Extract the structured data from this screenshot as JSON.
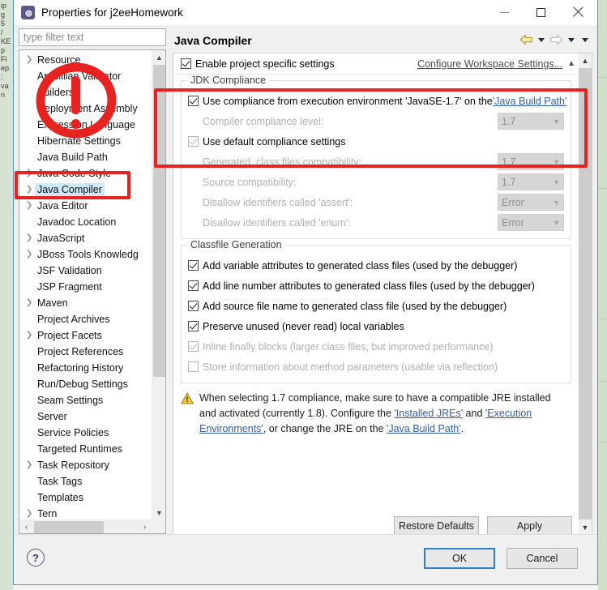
{
  "window": {
    "title": "Properties for j2eeHomework",
    "icon": "eclipse-properties-icon",
    "minimize_label": "Minimize",
    "maximize_label": "Maximize",
    "close_label": "Close"
  },
  "sidebar": {
    "filter_placeholder": "type filter text",
    "items": [
      {
        "label": "Resource",
        "expandable": true,
        "selected": false
      },
      {
        "label": "Arquillian Validator",
        "expandable": false,
        "selected": false
      },
      {
        "label": "Builders",
        "expandable": false,
        "selected": false
      },
      {
        "label": "Deployment Assembly",
        "expandable": false,
        "selected": false
      },
      {
        "label": "Expression Language",
        "expandable": false,
        "selected": false
      },
      {
        "label": "Hibernate Settings",
        "expandable": false,
        "selected": false
      },
      {
        "label": "Java Build Path",
        "expandable": false,
        "selected": false
      },
      {
        "label": "Java Code Style",
        "expandable": true,
        "selected": false
      },
      {
        "label": "Java Compiler",
        "expandable": true,
        "selected": true
      },
      {
        "label": "Java Editor",
        "expandable": true,
        "selected": false
      },
      {
        "label": "Javadoc Location",
        "expandable": false,
        "selected": false
      },
      {
        "label": "JavaScript",
        "expandable": true,
        "selected": false
      },
      {
        "label": "JBoss Tools Knowledg",
        "expandable": true,
        "selected": false
      },
      {
        "label": "JSF Validation",
        "expandable": false,
        "selected": false
      },
      {
        "label": "JSP Fragment",
        "expandable": false,
        "selected": false
      },
      {
        "label": "Maven",
        "expandable": true,
        "selected": false
      },
      {
        "label": "Project Archives",
        "expandable": false,
        "selected": false
      },
      {
        "label": "Project Facets",
        "expandable": true,
        "selected": false
      },
      {
        "label": "Project References",
        "expandable": false,
        "selected": false
      },
      {
        "label": "Refactoring History",
        "expandable": false,
        "selected": false
      },
      {
        "label": "Run/Debug Settings",
        "expandable": false,
        "selected": false
      },
      {
        "label": "Seam Settings",
        "expandable": false,
        "selected": false
      },
      {
        "label": "Server",
        "expandable": false,
        "selected": false
      },
      {
        "label": "Service Policies",
        "expandable": false,
        "selected": false
      },
      {
        "label": "Targeted Runtimes",
        "expandable": false,
        "selected": false
      },
      {
        "label": "Task Repository",
        "expandable": true,
        "selected": false
      },
      {
        "label": "Task Tags",
        "expandable": false,
        "selected": false
      },
      {
        "label": "Templates",
        "expandable": false,
        "selected": false
      },
      {
        "label": "Tern",
        "expandable": true,
        "selected": false
      }
    ]
  },
  "page": {
    "title": "Java Compiler",
    "nav": {
      "back_icon": "back-arrow-icon",
      "back_menu_icon": "chevron-down-icon",
      "forward_icon": "forward-arrow-icon",
      "forward_menu_icon": "chevron-down-icon",
      "view_menu_icon": "chevron-down-icon"
    },
    "enable_specific": {
      "label": "Enable project specific settings",
      "checked": true,
      "workspace_link": "Configure Workspace Settings...",
      "collapse_icon": "chevron-up-icon"
    },
    "jdk_compliance": {
      "legend": "JDK Compliance",
      "use_execution_env": {
        "text_before": "Use compliance from execution environment 'JavaSE-1.7' on the ",
        "link": "'Java Build Path'",
        "checked": true,
        "enabled": true
      },
      "compiler_compliance_level": {
        "label": "Compiler compliance level:",
        "value": "1.7",
        "enabled": false
      },
      "use_default_compliance": {
        "label": "Use default compliance settings",
        "checked": true,
        "enabled": false
      },
      "generated_class_compat": {
        "label": "Generated .class files compatibility:",
        "value": "1.7",
        "enabled": false
      },
      "source_compat": {
        "label": "Source compatibility:",
        "value": "1.7",
        "enabled": false
      },
      "disallow_assert": {
        "label": "Disallow identifiers called 'assert':",
        "value": "Error",
        "enabled": false
      },
      "disallow_enum": {
        "label": "Disallow identifiers called 'enum':",
        "value": "Error",
        "enabled": false
      }
    },
    "classfile_generation": {
      "legend": "Classfile Generation",
      "options": [
        {
          "label": "Add variable attributes to generated class files (used by the debugger)",
          "checked": true,
          "enabled": true
        },
        {
          "label": "Add line number attributes to generated class files (used by the debugger)",
          "checked": true,
          "enabled": true
        },
        {
          "label": "Add source file name to generated class file (used by the debugger)",
          "checked": true,
          "enabled": true
        },
        {
          "label": "Preserve unused (never read) local variables",
          "checked": true,
          "enabled": true
        },
        {
          "label": "Inline finally blocks (larger class files, but improved performance)",
          "checked": true,
          "enabled": false
        },
        {
          "label": "Store information about method parameters (usable via reflection)",
          "checked": false,
          "enabled": false
        }
      ]
    },
    "warning": {
      "icon": "warning-triangle-icon",
      "part1": "When selecting 1.7 compliance, make sure to have a compatible JRE installed and activated (currently 1.8). Configure the ",
      "link1": "'Installed JREs'",
      "part2": " and ",
      "link2": "'Execution Environments'",
      "part3": ", or change the JRE on the ",
      "link3": "'Java Build Path'",
      "part4": "."
    },
    "buttons": {
      "restore_defaults": "Restore Defaults",
      "apply": "Apply"
    }
  },
  "footer": {
    "help_icon": "help-question-icon",
    "help_glyph": "?",
    "ok": "OK",
    "cancel": "Cancel"
  },
  "annotations": {
    "color": "#e8221f",
    "circle_exclamation": "red-circled-exclamation-annotation",
    "tree_box": "red-box-java-compiler-annotation",
    "jdk_box": "red-box-jdk-compliance-annotation"
  },
  "background_window": {
    "left_strip_lines": [
      "ip",
      "g",
      "5",
      "",
      "",
      "",
      "",
      "",
      "",
      "",
      "",
      "",
      "",
      "",
      "",
      "",
      "",
      "",
      "",
      "/",
      "KE",
      "",
      "",
      "p",
      "Fi",
      "",
      "ep",
      ":",
      "va",
      "",
      "n"
    ]
  }
}
